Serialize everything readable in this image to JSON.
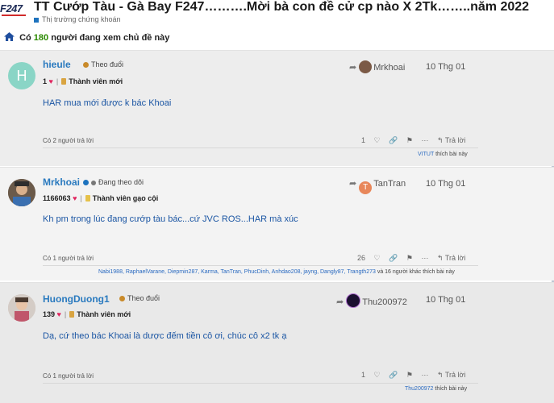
{
  "header": {
    "logo_text": "F247",
    "title": "TT Cướp Tàu - Gà Bay F247……….Mời bà con đề cử cp nào X 2Tk……..năm 2022",
    "category": "Thị trường chứng khoán",
    "viewers_prefix": "Có",
    "viewers_count": "180",
    "viewers_suffix": "người đang xem chủ đề này"
  },
  "posts": [
    {
      "avatar_letter": "H",
      "avatar_color": "#8ad5c6",
      "username": "hieule",
      "follow": "Theo đuổi",
      "likes": "1",
      "rank": "Thành viên mới",
      "reply_to": "Mrkhoai",
      "date": "10 Thg 01",
      "content": "HAR mua mới được k bác Khoai",
      "replies": "Có 2 người trả lời",
      "like_count": "1",
      "reply_btn": "Trả lời",
      "liked_by": "VITUT",
      "liked_suffix": "thích bài này"
    },
    {
      "username": "Mrkhoai",
      "follow": "Đang theo dõi",
      "likes": "1166063",
      "rank": "Thành viên gạo cội",
      "reply_to": "TanTran",
      "reply_to_letter": "T",
      "reply_to_color": "#e8875a",
      "date": "10 Thg 01",
      "content": "Kh pm trong lúc đang cướp tàu bác...cứ JVC ROS...HAR mà xúc",
      "replies": "Có 1 người trả lời",
      "like_count": "26",
      "reply_btn": "Trả lời",
      "liked_by": "Nabi1988, RaphaelVarane, Diepmin287, Karma, TanTran, PhucDinh, Anhdao208, jayng, Dangly87, Trangth273",
      "liked_suffix": "và 16 người khác thích bài này"
    },
    {
      "username": "HuongDuong1",
      "follow": "Theo đuổi",
      "likes": "139",
      "rank": "Thành viên mới",
      "reply_to": "Thu200972",
      "date": "10 Thg 01",
      "content": "Dạ, cứ theo bác Khoai là dược đếm tiền cô ơi, chúc cô x2 tk ạ",
      "replies": "Có 1 người trả lời",
      "like_count": "1",
      "reply_btn": "Trả lời",
      "liked_by": "Thu200972",
      "liked_suffix": "thích bài này"
    }
  ],
  "colors": {
    "link": "#2a7abf",
    "content": "#1a55a3",
    "heart": "#e0245e",
    "viewers": "#2b8a00"
  }
}
